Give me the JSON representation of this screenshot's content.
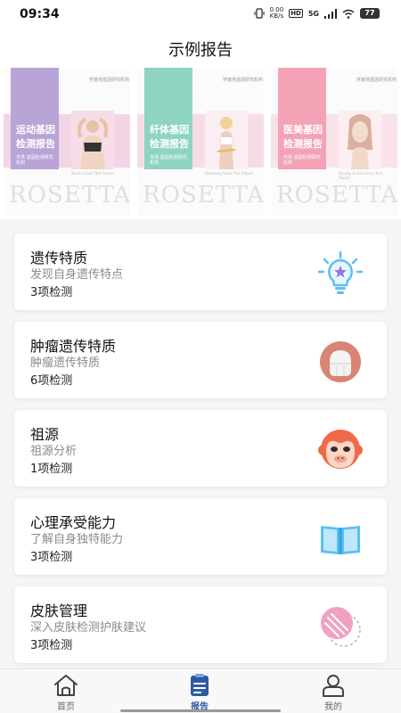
{
  "status": {
    "time": "09:34",
    "net_speed": "0.00",
    "net_unit": "KB/s",
    "hd": "HD",
    "signal": "5G",
    "battery": "77"
  },
  "header": {
    "title": "示例报告"
  },
  "samples": [
    {
      "label": "运动基因检测报告",
      "small": "市场 基因检测研究机构",
      "brand": "罗塞塔基因研究机构",
      "caption": "Sports Gene Test Report",
      "accent": "#b9a4d8",
      "band": "#e8a5c8",
      "rosetta": "ROSETTA"
    },
    {
      "label": "纤体基因检测报告",
      "small": "市场 基因检测研究机构",
      "brand": "罗塞塔基因研究机构",
      "caption": "Slimming Gene Test Report",
      "accent": "#8fd3c1",
      "band": "#f0b8c8",
      "rosetta": "ROSETTA"
    },
    {
      "label": "医美基因检测报告",
      "small": "市场 基因检测研究机构",
      "brand": "罗塞塔基因研究机构",
      "caption": "Beauty & Anti-Gene Test Report",
      "accent": "#f4a3b6",
      "band": "#f5c6d2",
      "rosetta": "ROSETTA"
    }
  ],
  "reports": [
    {
      "title": "遗传特质",
      "subtitle": "发现自身遗传特点",
      "count": "3项检测",
      "icon": "lightbulb-star-icon"
    },
    {
      "title": "肿瘤遗传特质",
      "subtitle": "肿瘤遗传特质",
      "count": "6项检测",
      "icon": "tumor-icon"
    },
    {
      "title": "祖源",
      "subtitle": "祖源分析",
      "count": "1项检测",
      "icon": "monkey-icon"
    },
    {
      "title": "心理承受能力",
      "subtitle": "了解自身独特能力",
      "count": "3项检测",
      "icon": "open-book-icon"
    },
    {
      "title": "皮肤管理",
      "subtitle": "深入皮肤检测护肤建议",
      "count": "3项检测",
      "icon": "skin-icon"
    }
  ],
  "tabs": [
    {
      "label": "首页",
      "icon": "home-icon",
      "active": false
    },
    {
      "label": "报告",
      "icon": "report-icon",
      "active": true
    },
    {
      "label": "我的",
      "icon": "profile-icon",
      "active": false
    }
  ],
  "colors": {
    "accent": "#2c5aa0",
    "bulb": "#5cc0f0",
    "monkey": "#f06a4a",
    "book": "#5cc0f0",
    "skin": "#f2a0c4"
  }
}
